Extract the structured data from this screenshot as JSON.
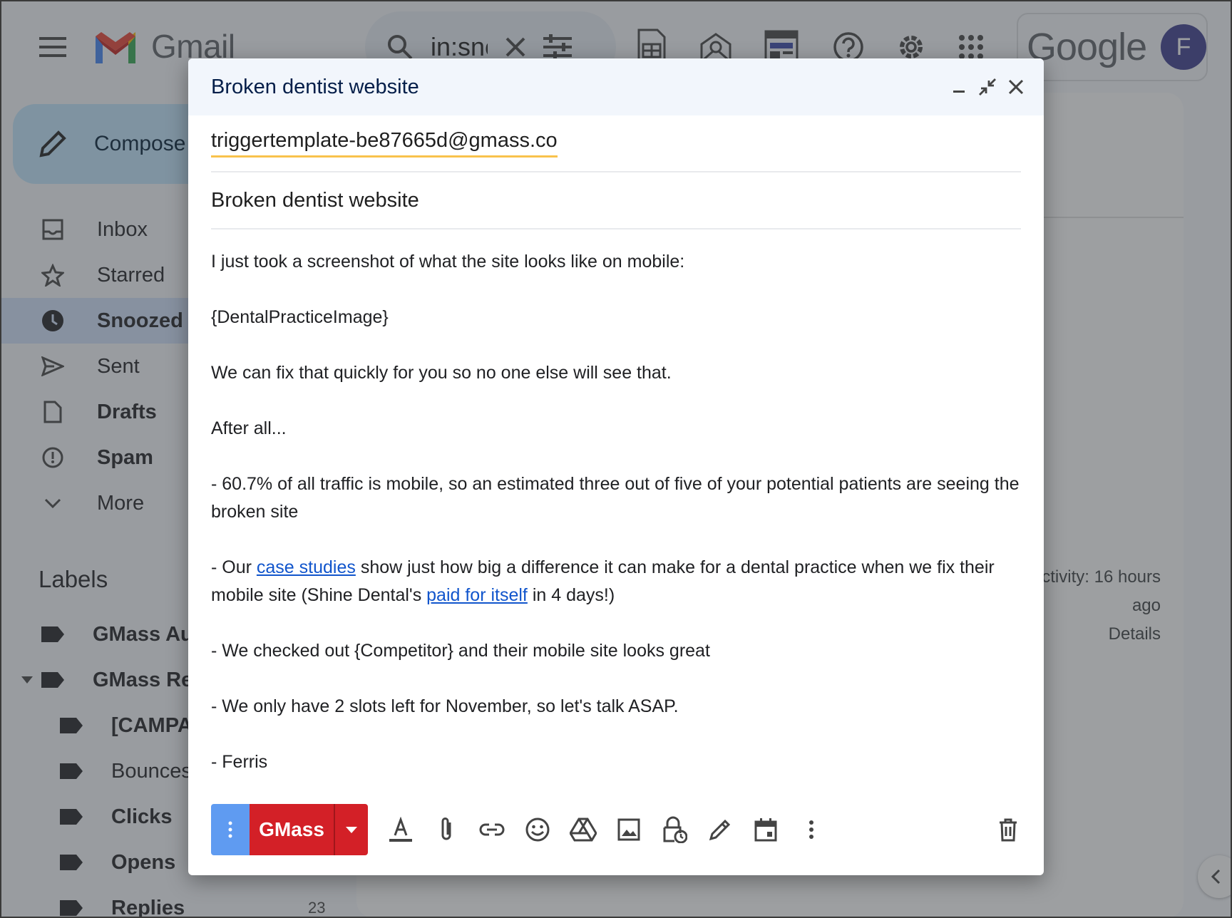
{
  "gmail": {
    "logo_text": "Gmail",
    "search_query": "in:snoozed",
    "google_text": "Google",
    "avatar_initial": "F",
    "compose_label": "Compose",
    "nav": [
      {
        "label": "Inbox",
        "icon": "inbox-icon"
      },
      {
        "label": "Starred",
        "icon": "star-icon"
      },
      {
        "label": "Snoozed",
        "icon": "clock-icon",
        "active": true
      },
      {
        "label": "Sent",
        "icon": "send-icon"
      },
      {
        "label": "Drafts",
        "icon": "draft-icon"
      },
      {
        "label": "Spam",
        "icon": "spam-icon"
      },
      {
        "label": "More",
        "icon": "chevron-down-icon"
      }
    ],
    "labels_title": "Labels",
    "labels": [
      {
        "label": "GMass Au"
      },
      {
        "label": "GMass Re"
      },
      {
        "label": "[CAMPA"
      },
      {
        "label": "Bounces"
      },
      {
        "label": "Clicks"
      },
      {
        "label": "Opens"
      },
      {
        "label": "Replies",
        "count": "23"
      }
    ],
    "activity_line1": "ctivity: 16 hours",
    "activity_line2": "ago",
    "details_link": "Details"
  },
  "compose": {
    "title": "Broken dentist website",
    "to": "triggertemplate-be87665d@gmass.co",
    "subject": "Broken dentist website",
    "body": {
      "p1": "I just took a screenshot of what the site looks like on mobile:",
      "p2": "{DentalPracticeImage}",
      "p3": "We can fix that quickly for you so no one else will see that.",
      "p4": "After all...",
      "p5": "- 60.7% of all traffic is mobile, so an estimated three out of five of your potential patients are seeing the broken site",
      "p6_a": "- Our ",
      "p6_link1": "case studies",
      "p6_b": " show just how big a difference it can make for a dental practice when we fix their mobile site (Shine Dental's ",
      "p6_link2": "paid for itself",
      "p6_c": " in 4 days!)",
      "p7": "- We checked out {Competitor} and their mobile site looks great",
      "p8": "- We only have 2 slots left for November, so let's talk ASAP.",
      "p9": "- Ferris"
    },
    "gmass_label": "GMass"
  },
  "colors": {
    "gmass_red": "#d32027",
    "options_blue": "#5f9bf1",
    "link_blue": "#1155cc",
    "overlay": "rgba(60,64,67,0.5)"
  }
}
